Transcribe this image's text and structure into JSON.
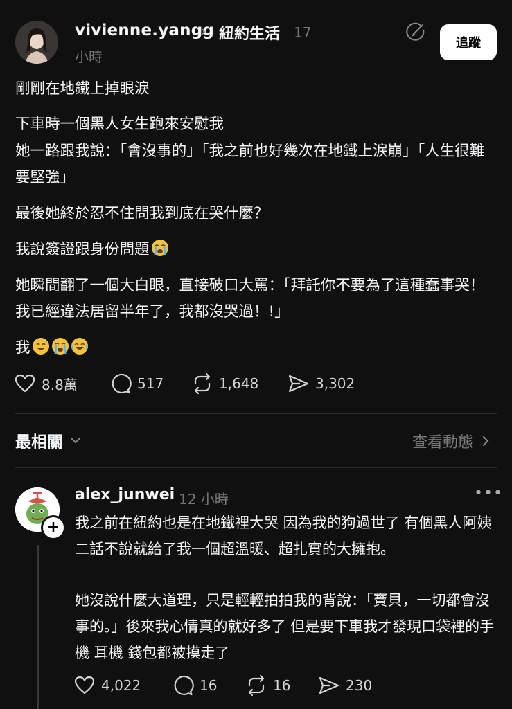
{
  "post": {
    "username": "vivienne.yangg",
    "community": "紐約生活",
    "time_num": "17",
    "time_unit": "小時",
    "follow_label": "追蹤",
    "paragraphs": [
      "剛剛在地鐵上掉眼淚",
      "下車時一個黑人女生跑來安慰我",
      "她一路跟我說：「會沒事的」「我之前也好幾次在地鐵上淚崩」「人生很難要堅強」",
      "最後她終於忍不住問我到底在哭什麼？",
      "我說簽證跟身份問題",
      "她瞬間翻了一個大白眼，直接破口大罵：「拜託你不要為了這種蠢事哭！我已經違法居留半年了，我都沒哭過！!」",
      "我"
    ],
    "stats": {
      "likes": "8.8萬",
      "comments": "517",
      "reposts": "1,648",
      "shares": "3,302"
    }
  },
  "replies_header": {
    "sort_label": "最相關",
    "activity_label": "查看動態"
  },
  "comment": {
    "username": "alex_junwei",
    "time": "12 小時",
    "more": "•••",
    "paragraphs": [
      "我之前在紐約也是在地鐵裡大哭 因為我的狗過世了 有個黑人阿姨二話不說就給了我一個超溫暖、超扎實的大擁抱。",
      "她沒說什麼大道理，只是輕輕拍拍我的背說：「寶貝，一切都會沒事的。」後來我心情真的就好多了 但是要下車我才發現口袋裡的手機 耳機 錢包都被摸走了"
    ],
    "stats": {
      "likes": "4,022",
      "comments": "16",
      "reposts": "16",
      "shares": "230"
    }
  },
  "icons": {
    "verified_edit": "edit-circle-icon",
    "like": "heart-icon",
    "comment": "comment-bubble-icon",
    "repost": "repost-icon",
    "share": "send-icon",
    "chevron_down": "chevron-down-icon",
    "chevron_right": "chevron-right-icon",
    "emojis": [
      "loudly-crying-face-icon",
      "sweat-smile-face-icon",
      "loudly-crying-face-icon",
      "tears-of-joy-face-icon"
    ]
  },
  "colors": {
    "background": "#101010",
    "text": "#f3f5f7",
    "muted": "#777777",
    "button_bg": "#ffffff"
  }
}
